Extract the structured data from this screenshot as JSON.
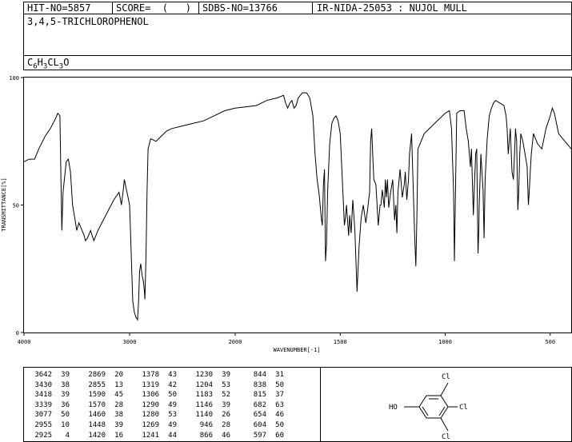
{
  "header": {
    "hit_no": "HIT-NO=5857",
    "score": "SCORE=  (   )",
    "sdbs_no": "SDBS-NO=13766",
    "ir_code": "IR-NIDA-25053 : NUJOL MULL",
    "compound_name": "3,4,5-TRICHLOROPHENOL",
    "formula": {
      "c": "C",
      "c_n": "6",
      "h": "H",
      "h_n": "3",
      "cl": "CL",
      "cl_n": "3",
      "o": "O"
    }
  },
  "chart_data": {
    "type": "line",
    "title": "",
    "xlabel": "WAVENUMBER[-1]",
    "ylabel": "TRANSMITTANCE[%]",
    "xlim": [
      4000,
      400
    ],
    "ylim": [
      0,
      100
    ],
    "x_ticks": [
      "4000",
      "3000",
      "2000",
      "1500",
      "1000",
      "500"
    ],
    "y_ticks": [
      "0",
      "50",
      "100"
    ],
    "grid": false,
    "series": [
      {
        "name": "",
        "points": [
          [
            4000,
            67
          ],
          [
            3950,
            68
          ],
          [
            3900,
            68
          ],
          [
            3860,
            72
          ],
          [
            3800,
            77
          ],
          [
            3750,
            80
          ],
          [
            3700,
            84
          ],
          [
            3680,
            86
          ],
          [
            3660,
            85
          ],
          [
            3650,
            60
          ],
          [
            3642,
            40
          ],
          [
            3630,
            55
          ],
          [
            3600,
            67
          ],
          [
            3580,
            68
          ],
          [
            3560,
            63
          ],
          [
            3540,
            50
          ],
          [
            3520,
            45
          ],
          [
            3500,
            40
          ],
          [
            3480,
            43
          ],
          [
            3450,
            40
          ],
          [
            3430,
            38
          ],
          [
            3418,
            36
          ],
          [
            3400,
            37
          ],
          [
            3370,
            40
          ],
          [
            3339,
            36
          ],
          [
            3300,
            40
          ],
          [
            3250,
            44
          ],
          [
            3200,
            48
          ],
          [
            3150,
            52
          ],
          [
            3100,
            55
          ],
          [
            3077,
            50
          ],
          [
            3060,
            56
          ],
          [
            3050,
            60
          ],
          [
            3040,
            58
          ],
          [
            3020,
            54
          ],
          [
            3010,
            52
          ],
          [
            3000,
            50
          ],
          [
            2990,
            38
          ],
          [
            2980,
            25
          ],
          [
            2970,
            12
          ],
          [
            2955,
            8
          ],
          [
            2940,
            6
          ],
          [
            2925,
            5
          ],
          [
            2915,
            12
          ],
          [
            2905,
            24
          ],
          [
            2895,
            27
          ],
          [
            2880,
            22
          ],
          [
            2869,
            20
          ],
          [
            2860,
            16
          ],
          [
            2855,
            13
          ],
          [
            2845,
            30
          ],
          [
            2835,
            55
          ],
          [
            2825,
            72
          ],
          [
            2800,
            76
          ],
          [
            2750,
            75
          ],
          [
            2700,
            77
          ],
          [
            2650,
            79
          ],
          [
            2600,
            80
          ],
          [
            2500,
            81
          ],
          [
            2400,
            82
          ],
          [
            2300,
            83
          ],
          [
            2200,
            85
          ],
          [
            2100,
            87
          ],
          [
            2000,
            88
          ],
          [
            1900,
            89
          ],
          [
            1850,
            91
          ],
          [
            1800,
            92
          ],
          [
            1770,
            93
          ],
          [
            1760,
            90
          ],
          [
            1750,
            88
          ],
          [
            1740,
            90
          ],
          [
            1730,
            91
          ],
          [
            1720,
            88
          ],
          [
            1710,
            89
          ],
          [
            1700,
            92
          ],
          [
            1680,
            94
          ],
          [
            1660,
            94
          ],
          [
            1645,
            92
          ],
          [
            1630,
            85
          ],
          [
            1620,
            70
          ],
          [
            1610,
            60
          ],
          [
            1600,
            54
          ],
          [
            1590,
            45
          ],
          [
            1585,
            42
          ],
          [
            1580,
            58
          ],
          [
            1575,
            64
          ],
          [
            1570,
            28
          ],
          [
            1565,
            35
          ],
          [
            1560,
            55
          ],
          [
            1550,
            74
          ],
          [
            1540,
            82
          ],
          [
            1530,
            84
          ],
          [
            1520,
            85
          ],
          [
            1510,
            83
          ],
          [
            1500,
            78
          ],
          [
            1490,
            60
          ],
          [
            1480,
            42
          ],
          [
            1475,
            45
          ],
          [
            1470,
            50
          ],
          [
            1460,
            38
          ],
          [
            1455,
            46
          ],
          [
            1448,
            39
          ],
          [
            1440,
            52
          ],
          [
            1430,
            40
          ],
          [
            1420,
            16
          ],
          [
            1410,
            34
          ],
          [
            1400,
            45
          ],
          [
            1390,
            50
          ],
          [
            1378,
            43
          ],
          [
            1370,
            48
          ],
          [
            1360,
            55
          ],
          [
            1355,
            75
          ],
          [
            1350,
            80
          ],
          [
            1345,
            70
          ],
          [
            1340,
            60
          ],
          [
            1330,
            58
          ],
          [
            1319,
            42
          ],
          [
            1310,
            50
          ],
          [
            1306,
            50
          ],
          [
            1300,
            56
          ],
          [
            1290,
            49
          ],
          [
            1285,
            60
          ],
          [
            1280,
            53
          ],
          [
            1275,
            60
          ],
          [
            1269,
            49
          ],
          [
            1260,
            55
          ],
          [
            1250,
            60
          ],
          [
            1241,
            44
          ],
          [
            1235,
            50
          ],
          [
            1230,
            39
          ],
          [
            1225,
            55
          ],
          [
            1215,
            64
          ],
          [
            1204,
            53
          ],
          [
            1195,
            58
          ],
          [
            1190,
            63
          ],
          [
            1183,
            52
          ],
          [
            1175,
            60
          ],
          [
            1170,
            70
          ],
          [
            1160,
            78
          ],
          [
            1146,
            39
          ],
          [
            1140,
            26
          ],
          [
            1135,
            45
          ],
          [
            1130,
            72
          ],
          [
            1100,
            78
          ],
          [
            1050,
            82
          ],
          [
            1000,
            86
          ],
          [
            980,
            87
          ],
          [
            970,
            80
          ],
          [
            960,
            55
          ],
          [
            956,
            28
          ],
          [
            950,
            60
          ],
          [
            945,
            86
          ],
          [
            930,
            87
          ],
          [
            910,
            87
          ],
          [
            900,
            80
          ],
          [
            890,
            75
          ],
          [
            880,
            65
          ],
          [
            875,
            72
          ],
          [
            866,
            46
          ],
          [
            860,
            60
          ],
          [
            855,
            70
          ],
          [
            850,
            72
          ],
          [
            844,
            31
          ],
          [
            840,
            40
          ],
          [
            838,
            50
          ],
          [
            830,
            70
          ],
          [
            820,
            56
          ],
          [
            815,
            37
          ],
          [
            810,
            60
          ],
          [
            800,
            76
          ],
          [
            790,
            85
          ],
          [
            780,
            88
          ],
          [
            770,
            90
          ],
          [
            760,
            91
          ],
          [
            740,
            90
          ],
          [
            720,
            89
          ],
          [
            710,
            85
          ],
          [
            705,
            80
          ],
          [
            700,
            70
          ],
          [
            695,
            75
          ],
          [
            690,
            80
          ],
          [
            682,
            63
          ],
          [
            675,
            60
          ],
          [
            670,
            70
          ],
          [
            665,
            80
          ],
          [
            660,
            75
          ],
          [
            654,
            48
          ],
          [
            650,
            55
          ],
          [
            645,
            70
          ],
          [
            640,
            78
          ],
          [
            630,
            75
          ],
          [
            620,
            70
          ],
          [
            610,
            65
          ],
          [
            604,
            50
          ],
          [
            600,
            55
          ],
          [
            597,
            60
          ],
          [
            590,
            70
          ],
          [
            580,
            78
          ],
          [
            560,
            74
          ],
          [
            540,
            72
          ],
          [
            520,
            80
          ],
          [
            500,
            85
          ],
          [
            490,
            88
          ],
          [
            480,
            86
          ],
          [
            470,
            82
          ],
          [
            460,
            78
          ],
          [
            450,
            77
          ],
          [
            440,
            76
          ],
          [
            430,
            75
          ],
          [
            420,
            74
          ],
          [
            410,
            73
          ],
          [
            400,
            72
          ]
        ]
      }
    ]
  },
  "peak_table": {
    "columns": [
      [
        [
          "3642",
          "39"
        ],
        [
          "3430",
          "38"
        ],
        [
          "3418",
          "39"
        ],
        [
          "3339",
          "36"
        ],
        [
          "3077",
          "50"
        ],
        [
          "2955",
          "10"
        ],
        [
          "2925",
          "4"
        ]
      ],
      [
        [
          "2869",
          "20"
        ],
        [
          "2855",
          "13"
        ],
        [
          "1590",
          "45"
        ],
        [
          "1570",
          "28"
        ],
        [
          "1460",
          "38"
        ],
        [
          "1448",
          "39"
        ],
        [
          "1420",
          "16"
        ]
      ],
      [
        [
          "1378",
          "43"
        ],
        [
          "1319",
          "42"
        ],
        [
          "1306",
          "50"
        ],
        [
          "1290",
          "49"
        ],
        [
          "1280",
          "53"
        ],
        [
          "1269",
          "49"
        ],
        [
          "1241",
          "44"
        ]
      ],
      [
        [
          "1230",
          "39"
        ],
        [
          "1204",
          "53"
        ],
        [
          "1183",
          "52"
        ],
        [
          "1146",
          "39"
        ],
        [
          "1140",
          "26"
        ],
        [
          "946",
          "28"
        ],
        [
          "866",
          "46"
        ]
      ],
      [
        [
          "844",
          "31"
        ],
        [
          "838",
          "50"
        ],
        [
          "815",
          "37"
        ],
        [
          "682",
          "63"
        ],
        [
          "654",
          "46"
        ],
        [
          "604",
          "50"
        ],
        [
          "597",
          "60"
        ]
      ]
    ]
  },
  "structure": {
    "label_ho": "HO",
    "label_cl_top": "Cl",
    "label_cl_right": "Cl",
    "label_cl_bottom": "Cl"
  }
}
